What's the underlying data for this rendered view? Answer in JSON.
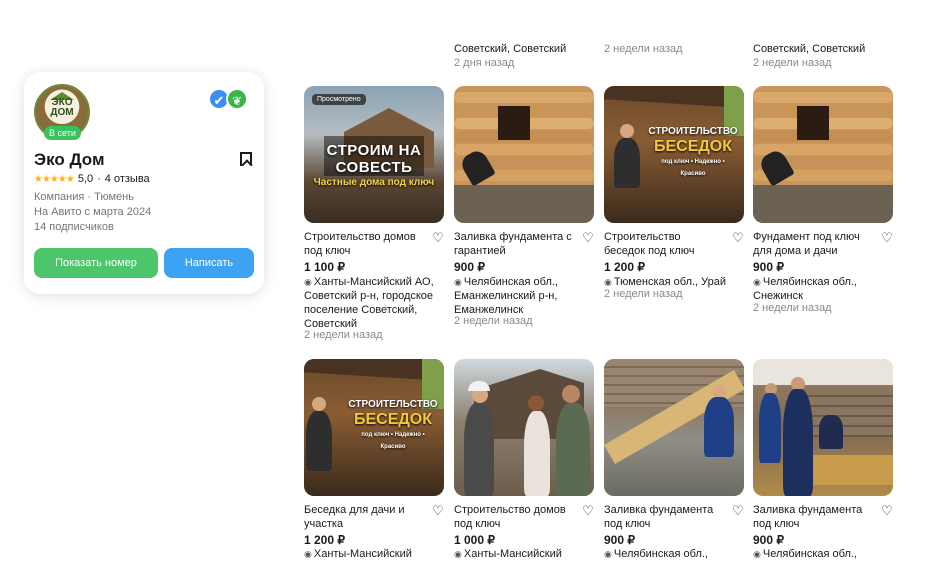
{
  "top_partial": [
    {
      "location": "Советский, Советский",
      "time": "2 дня назад"
    },
    {
      "location": "",
      "time": "2 недели назад"
    },
    {
      "location": "Советский, Советский",
      "time": "2 недели назад"
    }
  ],
  "seller": {
    "logo_text": "ЭКО ДОМ",
    "online": "В сети",
    "name": "Эко Дом",
    "stars": "★★★★★",
    "rating": "5,0",
    "reviews": "4 отзыва",
    "type_city": "Компания · Тюмень",
    "since": "На Авито с марта 2024",
    "subscribers": "14 подписчиков",
    "phone_button": "Показать номер",
    "write_button": "Написать",
    "colors": {
      "phone": "#4cc56b",
      "write": "#3ea2f3",
      "stars": "#ffb021"
    }
  },
  "listings": [
    {
      "title": "Строительство домов под ключ",
      "price": "1 100 ₽",
      "location": "Ханты-Мансийский АО, Советский р-н, городское поселение Советский, Советский",
      "time": "2 недели назад",
      "promo": "Просмотрено",
      "banner": "СТРОИМ НА СОВЕСТЬ",
      "banner_sub": "Частные дома под ключ",
      "icon": "heart-icon"
    },
    {
      "title": "Заливка фундамента с гарантией",
      "price": "900 ₽",
      "location": "Челябинская обл., Еманжелинский р-н, Еманжелинск",
      "time": "2 недели назад",
      "icon": "heart-icon"
    },
    {
      "title": "Строительство беседок под ключ",
      "price": "1 200 ₽",
      "location": "Тюменская обл., Урай",
      "time": "2 недели назад",
      "banner": "СТРОИТЕЛЬСТВО",
      "banner_big": "БЕСЕДОК",
      "banner_sub": "под ключ • Надежно • Красиво",
      "icon": "heart-icon"
    },
    {
      "title": "Фундамент под ключ для дома и дачи",
      "price": "900 ₽",
      "location": "Челябинская обл., Снежинск",
      "time": "2 недели назад",
      "icon": "heart-icon"
    },
    {
      "title": "Беседка для дачи и участка",
      "price": "1 200 ₽",
      "location": "Ханты-Мансийский",
      "banner": "СТРОИТЕЛЬСТВО",
      "banner_big": "БЕСЕДОК",
      "banner_sub": "под ключ • Надежно • Красиво",
      "icon": "heart-icon"
    },
    {
      "title": "Строительство домов под ключ",
      "price": "1 000 ₽",
      "location": "Ханты-Мансийский",
      "icon": "heart-icon"
    },
    {
      "title": "Заливка фундамента под ключ",
      "price": "900 ₽",
      "location": "Челябинская обл.,",
      "icon": "heart-icon"
    },
    {
      "title": "Заливка фундамента под ключ",
      "price": "900 ₽",
      "location": "Челябинская обл.,",
      "icon": "heart-icon"
    }
  ]
}
